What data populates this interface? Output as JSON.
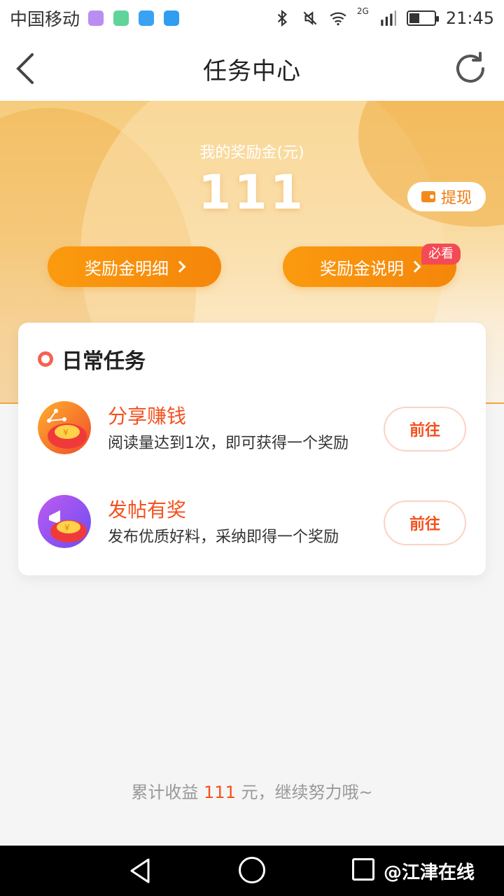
{
  "status_bar": {
    "carrier": "中国移动",
    "network": "2G",
    "time": "21:45",
    "icons": [
      "gallery-icon",
      "eye-icon",
      "heart-icon",
      "chat-icon",
      "bluetooth-icon",
      "mute-icon",
      "wifi-icon",
      "signal-icon",
      "battery-icon"
    ]
  },
  "header": {
    "title": "任务中心",
    "back_icon": "chevron-left-icon",
    "refresh_icon": "refresh-icon"
  },
  "reward": {
    "label": "我的奖励金(元)",
    "amount": "111",
    "withdraw_label": "提现",
    "detail_label": "奖励金明细",
    "explain_label": "奖励金说明",
    "must_read_badge": "必看"
  },
  "daily_tasks": {
    "title": "日常任务",
    "items": [
      {
        "name": "分享赚钱",
        "desc": "阅读量达到1次，即可获得一个奖励",
        "button": "前往",
        "icon": "share-money-icon"
      },
      {
        "name": "发帖有奖",
        "desc": "发布优质好料，采纳即得一个奖励",
        "button": "前往",
        "icon": "post-reward-icon"
      }
    ]
  },
  "footer": {
    "prefix": "累计收益",
    "amount": "111",
    "suffix": "元，继续努力哦~"
  },
  "nav_bar": {
    "watermark": "@江津在线"
  },
  "colors": {
    "accent": "#f5860a",
    "task_title": "#f4511e",
    "badge": "#f44a55"
  }
}
